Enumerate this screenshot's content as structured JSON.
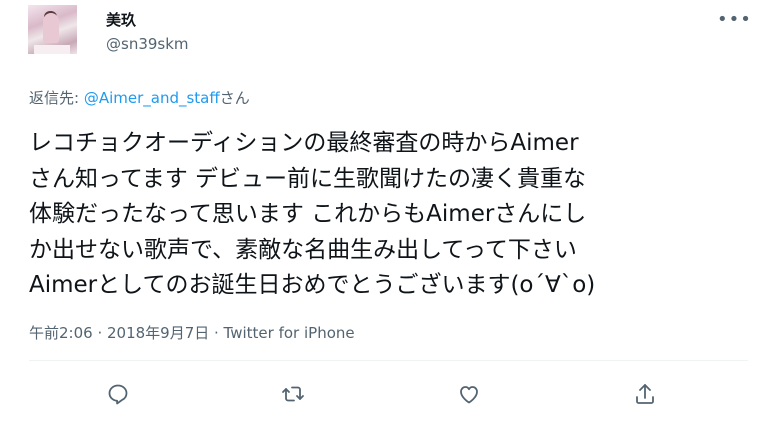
{
  "author": {
    "display_name": "美玖",
    "username": "@sn39skm"
  },
  "reply": {
    "prefix": "返信先: ",
    "mention": "@Aimer_and_staff",
    "suffix": "さん"
  },
  "tweet": {
    "text": "レコチョクオーディションの最終審査の時からAimer\nさん知ってます デビュー前に生歌聞けたの凄く貴重な\n体験だったなって思います これからもAimerさんにし\nか出せない歌声で、素敵な名曲生み出してって下さい\nAimerとしてのお誕生日おめでとうございます(o´∀`o)"
  },
  "meta": {
    "line": "午前2:06 · 2018年9月7日 · Twitter for iPhone"
  },
  "icons": {
    "more": "more-horizontal-icon",
    "reply": "reply-icon",
    "retweet": "retweet-icon",
    "like": "like-icon",
    "share": "share-icon"
  },
  "colors": {
    "link": "#1d9bf0",
    "secondary_text": "#536471",
    "primary_text": "#0f1419"
  }
}
